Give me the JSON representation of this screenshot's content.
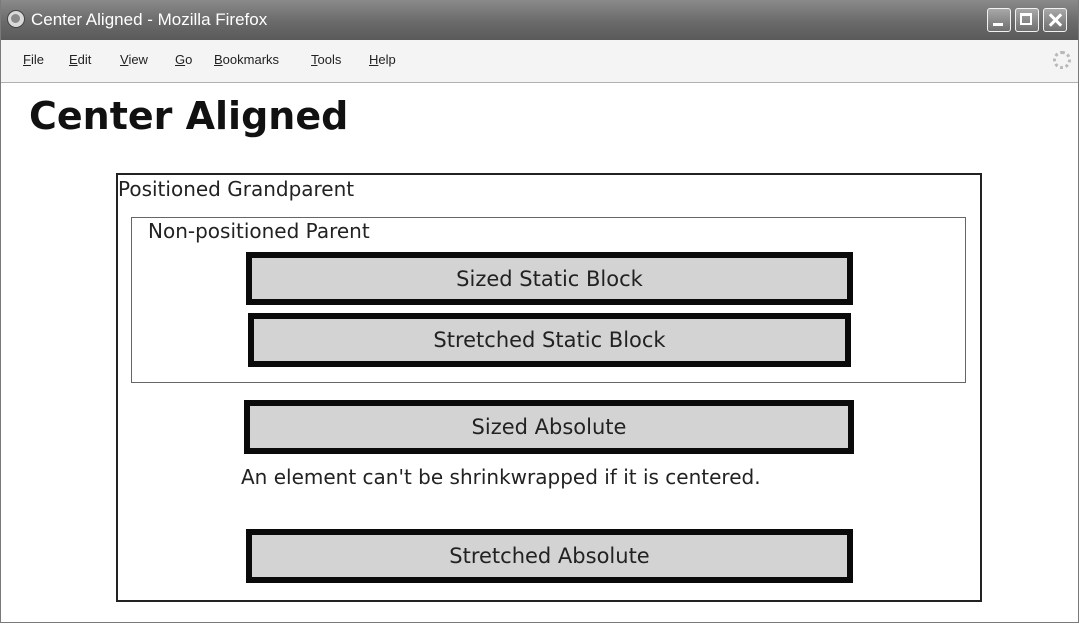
{
  "window": {
    "title": "Center Aligned - Mozilla Firefox",
    "icon": "firefox-icon",
    "controls": [
      "minimize-icon",
      "maximize-icon",
      "close-icon"
    ]
  },
  "menubar": {
    "items": [
      {
        "label": "File"
      },
      {
        "label": "Edit"
      },
      {
        "label": "View"
      },
      {
        "label": "Go"
      },
      {
        "label": "Bookmarks"
      },
      {
        "label": "Tools"
      },
      {
        "label": "Help"
      }
    ],
    "throbber_icon": "throbber-icon"
  },
  "page": {
    "heading": "Center Aligned",
    "grandparent_label": "Positioned Grandparent",
    "parent_label": "Non-positioned Parent",
    "blocks": {
      "sized_static": "Sized Static Block",
      "stretched_static": "Stretched Static Block",
      "sized_absolute": "Sized Absolute",
      "stretched_absolute": "Stretched Absolute"
    },
    "note": "An element can't be shrinkwrapped if it is centered."
  },
  "colors": {
    "titlebar": "#6f6f6f",
    "block_fill": "#d3d3d3",
    "block_border": "#0a0a0a"
  }
}
